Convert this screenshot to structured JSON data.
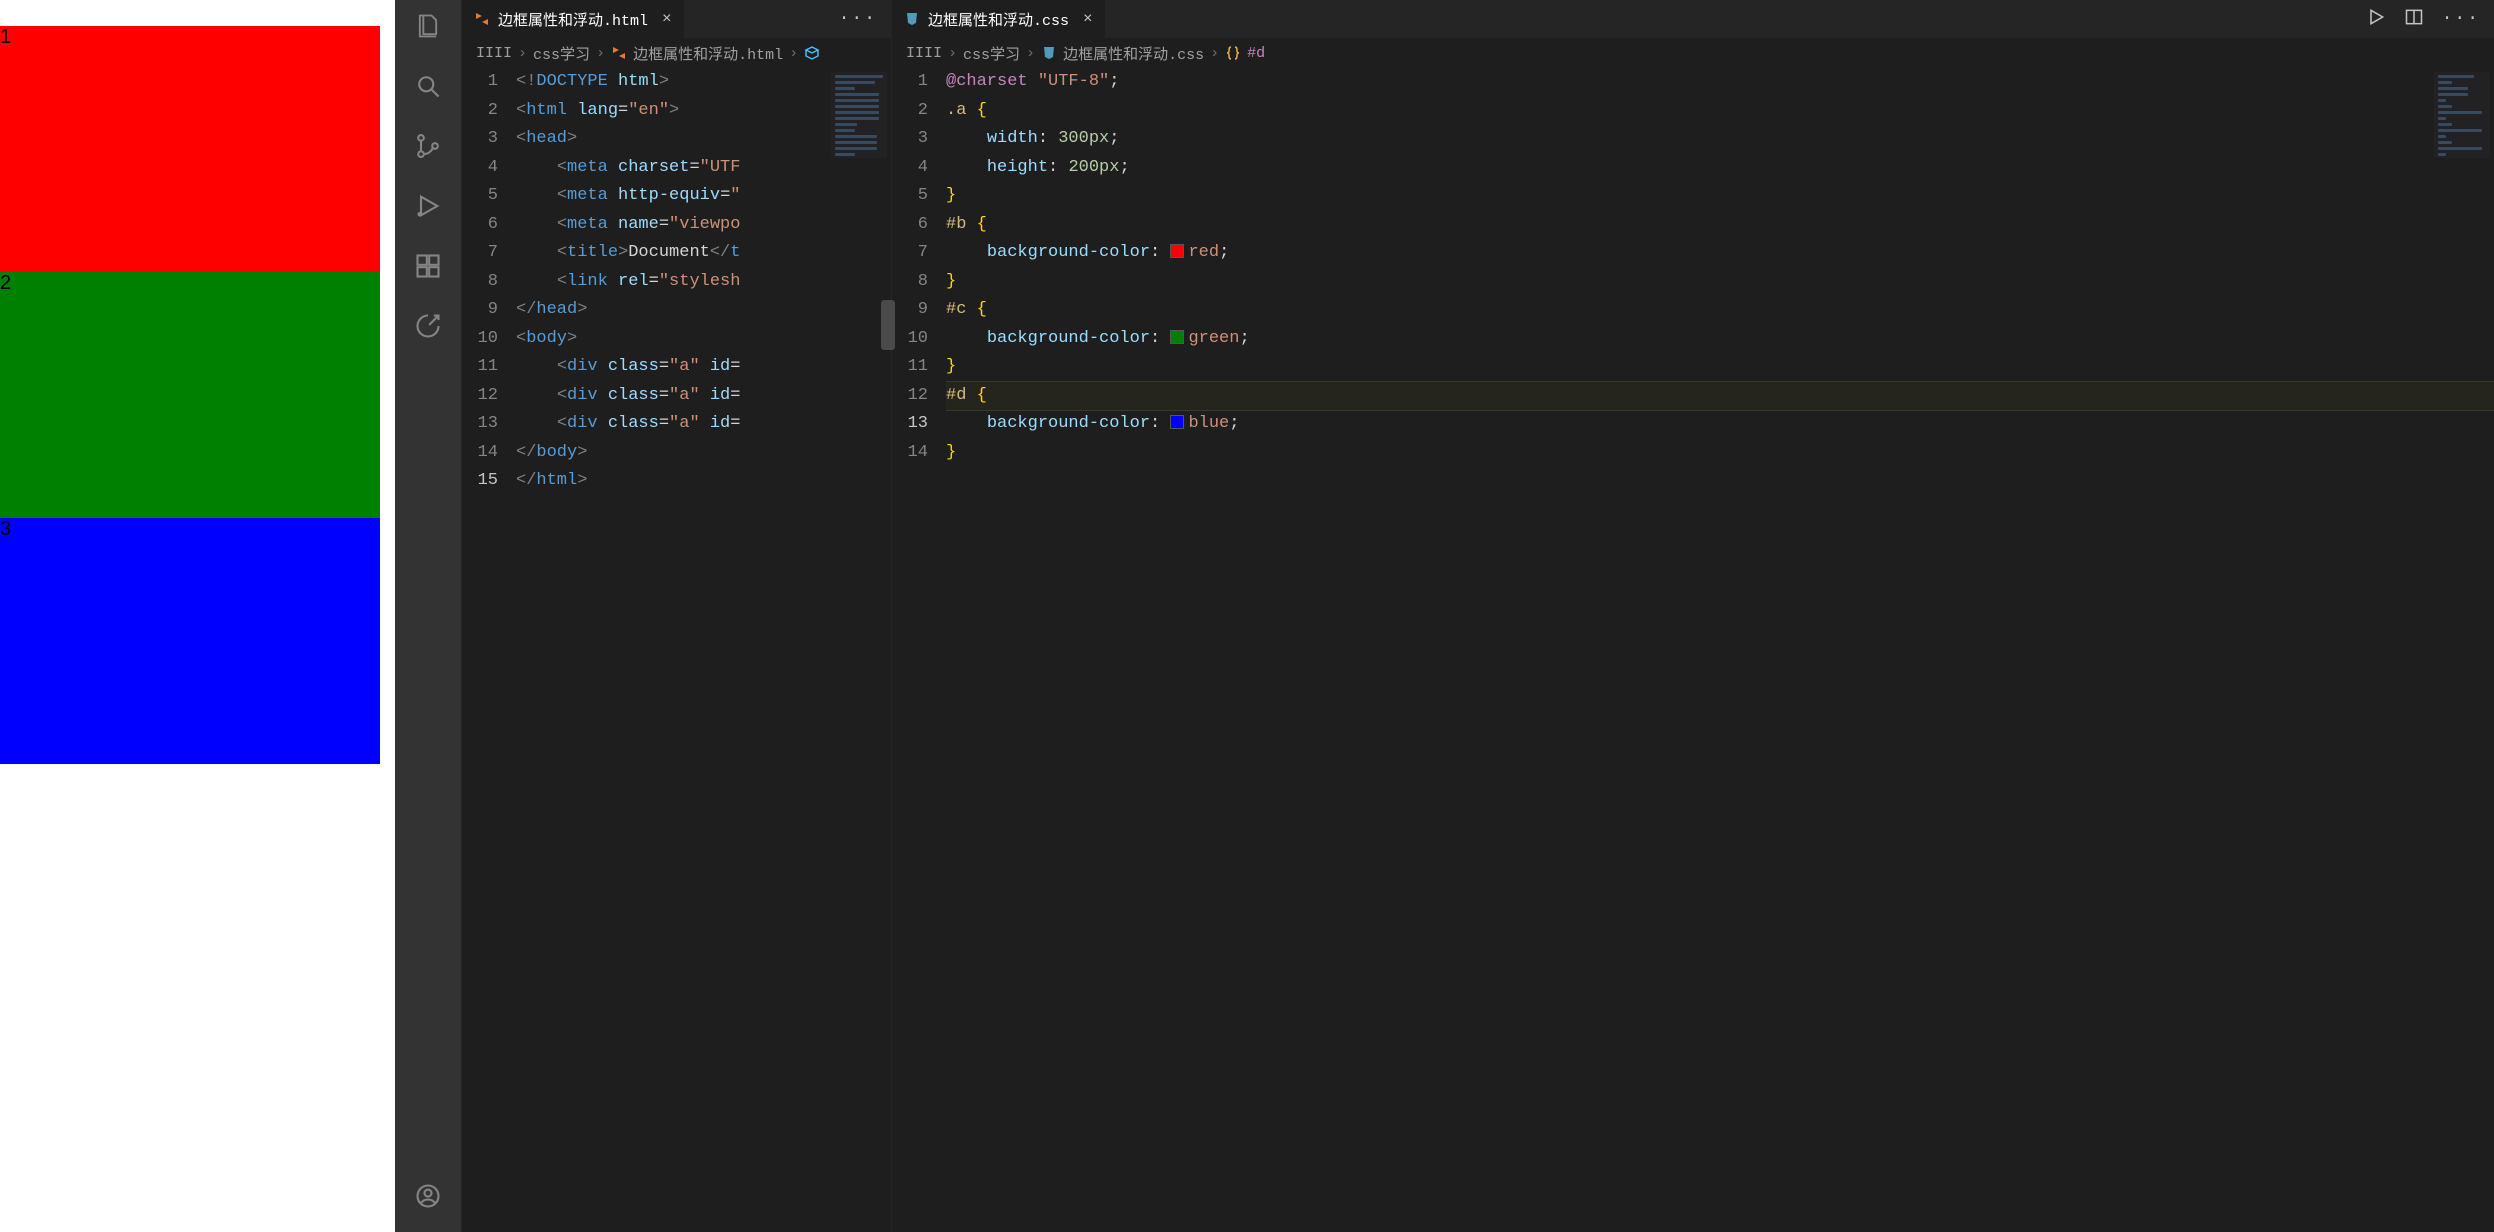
{
  "preview": {
    "labels": [
      "1",
      "2",
      "3"
    ]
  },
  "activity": {
    "icons": [
      "files",
      "search",
      "source-control",
      "run-debug",
      "extensions",
      "remote",
      "account"
    ]
  },
  "editor_left": {
    "tab": {
      "filename": "边框属性和浮动.html"
    },
    "breadcrumbs": {
      "root": "IIII",
      "folder": "css学习",
      "file": "边框属性和浮动.html"
    },
    "code": {
      "line_count": 15,
      "active_line": 15,
      "lines": [
        {
          "n": 1,
          "tokens": [
            [
              "gray",
              "<!"
            ],
            [
              "tag",
              "DOCTYPE"
            ],
            [
              "text",
              " "
            ],
            [
              "attr",
              "html"
            ],
            [
              "gray",
              ">"
            ]
          ]
        },
        {
          "n": 2,
          "tokens": [
            [
              "gray",
              "<"
            ],
            [
              "tag",
              "html"
            ],
            [
              "text",
              " "
            ],
            [
              "attr",
              "lang"
            ],
            [
              "punc",
              "="
            ],
            [
              "str",
              "\"en\""
            ],
            [
              "gray",
              ">"
            ]
          ]
        },
        {
          "n": 3,
          "tokens": [
            [
              "gray",
              "<"
            ],
            [
              "tag",
              "head"
            ],
            [
              "gray",
              ">"
            ]
          ]
        },
        {
          "n": 4,
          "tokens": [
            [
              "text",
              "    "
            ],
            [
              "gray",
              "<"
            ],
            [
              "tag",
              "meta"
            ],
            [
              "text",
              " "
            ],
            [
              "attr",
              "charset"
            ],
            [
              "punc",
              "="
            ],
            [
              "str",
              "\"UTF"
            ]
          ]
        },
        {
          "n": 5,
          "tokens": [
            [
              "text",
              "    "
            ],
            [
              "gray",
              "<"
            ],
            [
              "tag",
              "meta"
            ],
            [
              "text",
              " "
            ],
            [
              "attr",
              "http-equiv"
            ],
            [
              "punc",
              "="
            ],
            [
              "str",
              "\""
            ]
          ]
        },
        {
          "n": 6,
          "tokens": [
            [
              "text",
              "    "
            ],
            [
              "gray",
              "<"
            ],
            [
              "tag",
              "meta"
            ],
            [
              "text",
              " "
            ],
            [
              "attr",
              "name"
            ],
            [
              "punc",
              "="
            ],
            [
              "str",
              "\"viewpo"
            ]
          ]
        },
        {
          "n": 7,
          "tokens": [
            [
              "text",
              "    "
            ],
            [
              "gray",
              "<"
            ],
            [
              "tag",
              "title"
            ],
            [
              "gray",
              ">"
            ],
            [
              "text",
              "Document"
            ],
            [
              "gray",
              "</"
            ],
            [
              "tag",
              "t"
            ]
          ]
        },
        {
          "n": 8,
          "tokens": [
            [
              "text",
              "    "
            ],
            [
              "gray",
              "<"
            ],
            [
              "tag",
              "link"
            ],
            [
              "text",
              " "
            ],
            [
              "attr",
              "rel"
            ],
            [
              "punc",
              "="
            ],
            [
              "str",
              "\"stylesh"
            ]
          ]
        },
        {
          "n": 9,
          "tokens": [
            [
              "gray",
              "</"
            ],
            [
              "tag",
              "head"
            ],
            [
              "gray",
              ">"
            ]
          ]
        },
        {
          "n": 10,
          "tokens": [
            [
              "gray",
              "<"
            ],
            [
              "tag",
              "body"
            ],
            [
              "gray",
              ">"
            ]
          ]
        },
        {
          "n": 11,
          "tokens": [
            [
              "text",
              "    "
            ],
            [
              "gray",
              "<"
            ],
            [
              "tag",
              "div"
            ],
            [
              "text",
              " "
            ],
            [
              "attr",
              "class"
            ],
            [
              "punc",
              "="
            ],
            [
              "str",
              "\"a\""
            ],
            [
              "text",
              " "
            ],
            [
              "attr",
              "id"
            ],
            [
              "punc",
              "="
            ]
          ]
        },
        {
          "n": 12,
          "tokens": [
            [
              "text",
              "    "
            ],
            [
              "gray",
              "<"
            ],
            [
              "tag",
              "div"
            ],
            [
              "text",
              " "
            ],
            [
              "attr",
              "class"
            ],
            [
              "punc",
              "="
            ],
            [
              "str",
              "\"a\""
            ],
            [
              "text",
              " "
            ],
            [
              "attr",
              "id"
            ],
            [
              "punc",
              "="
            ]
          ]
        },
        {
          "n": 13,
          "tokens": [
            [
              "text",
              "    "
            ],
            [
              "gray",
              "<"
            ],
            [
              "tag",
              "div"
            ],
            [
              "text",
              " "
            ],
            [
              "attr",
              "class"
            ],
            [
              "punc",
              "="
            ],
            [
              "str",
              "\"a\""
            ],
            [
              "text",
              " "
            ],
            [
              "attr",
              "id"
            ],
            [
              "punc",
              "="
            ]
          ]
        },
        {
          "n": 14,
          "tokens": [
            [
              "gray",
              "</"
            ],
            [
              "tag",
              "body"
            ],
            [
              "gray",
              ">"
            ]
          ]
        },
        {
          "n": 15,
          "tokens": [
            [
              "gray",
              "</"
            ],
            [
              "tag",
              "html"
            ],
            [
              "gray",
              ">"
            ]
          ]
        }
      ]
    }
  },
  "editor_right": {
    "tab": {
      "filename": "边框属性和浮动.css"
    },
    "breadcrumbs": {
      "root": "IIII",
      "folder": "css学习",
      "file": "边框属性和浮动.css",
      "symbol": "#d"
    },
    "code": {
      "line_count": 14,
      "active_line": 13,
      "highlight_line": 12,
      "lines": [
        {
          "n": 1,
          "tokens": [
            [
              "atrule",
              "@charset"
            ],
            [
              "text",
              " "
            ],
            [
              "str",
              "\"UTF-8\""
            ],
            [
              "punc",
              ";"
            ]
          ]
        },
        {
          "n": 2,
          "tokens": [
            [
              "sel",
              ".a"
            ],
            [
              "text",
              " "
            ],
            [
              "ybrace",
              "{"
            ]
          ]
        },
        {
          "n": 3,
          "tokens": [
            [
              "text",
              "    "
            ],
            [
              "prop",
              "width"
            ],
            [
              "punc",
              ": "
            ],
            [
              "num",
              "300px"
            ],
            [
              "punc",
              ";"
            ]
          ]
        },
        {
          "n": 4,
          "tokens": [
            [
              "text",
              "    "
            ],
            [
              "prop",
              "height"
            ],
            [
              "punc",
              ": "
            ],
            [
              "num",
              "200px"
            ],
            [
              "punc",
              ";"
            ]
          ]
        },
        {
          "n": 5,
          "tokens": [
            [
              "ybrace",
              "}"
            ]
          ]
        },
        {
          "n": 6,
          "tokens": [
            [
              "sel",
              "#b"
            ],
            [
              "text",
              " "
            ],
            [
              "ybrace",
              "{"
            ]
          ]
        },
        {
          "n": 7,
          "tokens": [
            [
              "text",
              "    "
            ],
            [
              "prop",
              "background-color"
            ],
            [
              "punc",
              ": "
            ],
            [
              "swatch",
              "#ff0000"
            ],
            [
              "val",
              "red"
            ],
            [
              "punc",
              ";"
            ]
          ]
        },
        {
          "n": 8,
          "tokens": [
            [
              "ybrace",
              "}"
            ]
          ]
        },
        {
          "n": 9,
          "tokens": [
            [
              "sel",
              "#c"
            ],
            [
              "text",
              " "
            ],
            [
              "ybrace",
              "{"
            ]
          ]
        },
        {
          "n": 10,
          "tokens": [
            [
              "text",
              "    "
            ],
            [
              "prop",
              "background-color"
            ],
            [
              "punc",
              ": "
            ],
            [
              "swatch",
              "#008000"
            ],
            [
              "val",
              "green"
            ],
            [
              "punc",
              ";"
            ]
          ]
        },
        {
          "n": 11,
          "tokens": [
            [
              "ybrace",
              "}"
            ]
          ]
        },
        {
          "n": 12,
          "tokens": [
            [
              "sel",
              "#d"
            ],
            [
              "text",
              " "
            ],
            [
              "ybrace",
              "{"
            ]
          ]
        },
        {
          "n": 13,
          "tokens": [
            [
              "text",
              "    "
            ],
            [
              "prop",
              "background-color"
            ],
            [
              "punc",
              ": "
            ],
            [
              "swatch",
              "#0000ff"
            ],
            [
              "val",
              "blue"
            ],
            [
              "punc",
              ";"
            ]
          ]
        },
        {
          "n": 14,
          "tokens": [
            [
              "ybrace",
              "}"
            ]
          ]
        }
      ]
    }
  }
}
